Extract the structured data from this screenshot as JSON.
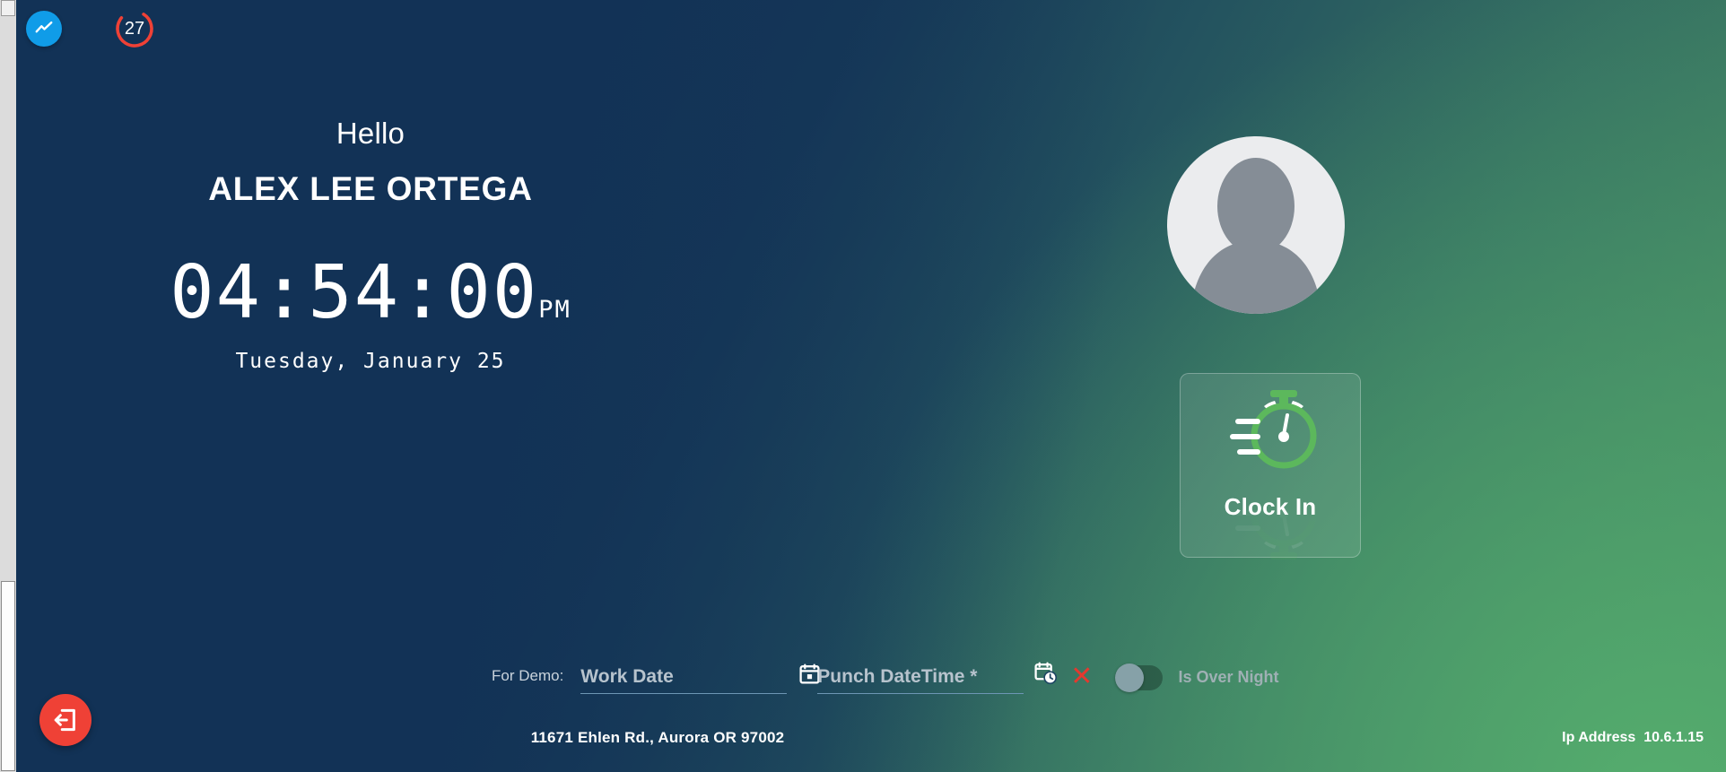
{
  "topbar": {
    "chart_icon": "chart-line-icon",
    "chart_icon_color": "#109ce8",
    "counter_value": "27",
    "counter_color": "#ef4136",
    "counter_progress_pct": 75
  },
  "greeting": {
    "salutation": "Hello",
    "user_name": "ALEX LEE ORTEGA"
  },
  "clock": {
    "time": "04:54:00",
    "meridiem": "PM",
    "date": "Tuesday, January 25"
  },
  "avatar": {
    "icon": "user-silhouette-icon"
  },
  "action": {
    "icon": "stopwatch-icon",
    "icon_color": "#5cb85c",
    "label": "Clock In"
  },
  "demo_form": {
    "prefix_label": "For Demo:",
    "work_date": {
      "label": "Work Date",
      "value": "",
      "placeholder": "Work Date",
      "icon": "calendar-icon"
    },
    "punch_datetime": {
      "label": "Punch DateTime *",
      "value": "",
      "placeholder": "Punch DateTime *",
      "icon": "calendar-clock-icon"
    },
    "clear_icon": "close-x-icon",
    "clear_color": "#e4392f",
    "overnight_toggle": {
      "label": "Is Over Night",
      "state": "off"
    }
  },
  "logout": {
    "icon": "logout-icon",
    "color": "#ef4136"
  },
  "footer": {
    "address": "11671 Ehlen Rd., Aurora OR 97002",
    "ip_label": "Ip Address",
    "ip_value": "10.6.1.15"
  }
}
